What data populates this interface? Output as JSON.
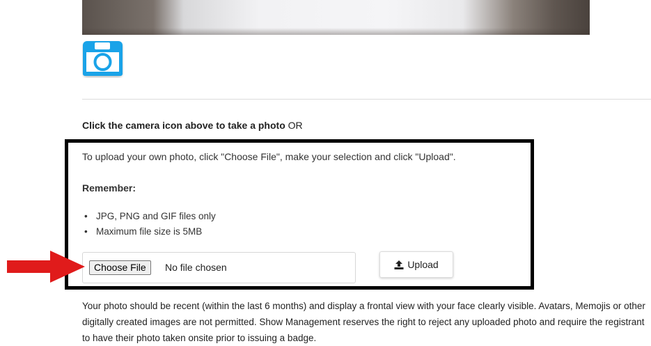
{
  "webcam": {
    "label": ""
  },
  "capture": {
    "instruction_bold": "Click the camera icon above to take a photo",
    "instruction_or": "OR"
  },
  "upload": {
    "intro": "To upload your own photo, click \"Choose File\", make your selection and click \"Upload\".",
    "remember_label": "Remember:",
    "rules": [
      "JPG, PNG and GIF files only",
      "Maximum file size is 5MB"
    ],
    "choose_file_label": "Choose File",
    "no_file_text": "No file chosen",
    "upload_button_label": "Upload"
  },
  "footnote": "Your photo should be recent (within the last 6 months) and display a frontal view with your face clearly visible. Avatars, Memojis or other digitally created images are not permitted. Show Management reserves the right to reject any uploaded photo and require the registrant to have their photo taken onsite prior to issuing a badge.",
  "colors": {
    "camera_accent": "#1aa3e8",
    "highlight_border": "#000000",
    "arrow": "#e01b1b"
  },
  "icons": {
    "camera": "camera-icon",
    "upload": "upload-icon",
    "pointer": "red-arrow-icon"
  }
}
